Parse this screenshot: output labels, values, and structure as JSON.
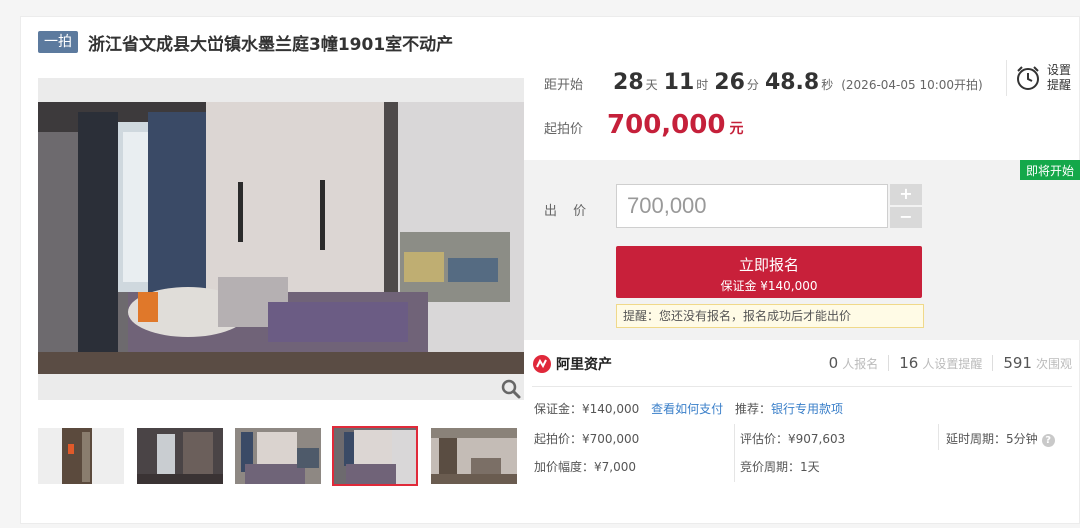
{
  "listing": {
    "tag": "一拍",
    "title": "浙江省文成县大峃镇水墨兰庭3幢1901室不动产"
  },
  "countdown": {
    "label": "距开始",
    "days": "28",
    "days_unit": "天",
    "hours": "11",
    "hours_unit": "时",
    "minutes": "26",
    "minutes_unit": "分",
    "seconds": "48.8",
    "seconds_unit": "秒",
    "start_time": "(2026-04-05 10:00开拍)"
  },
  "reminder": {
    "label": "设置 提醒",
    "icon": "alarm-clock-icon"
  },
  "start_price": {
    "label": "起拍价",
    "value": "700,000",
    "unit": "元"
  },
  "bid": {
    "status_badge": "即将开始",
    "label": "出 价",
    "input_value": "700,000",
    "plus": "+",
    "minus": "−",
    "signup_label": "立即报名",
    "deposit_label": "保证金 ¥140,000",
    "tip": "提醒：您还没有报名，报名成功后才能出价"
  },
  "platform": {
    "name": "阿里资产",
    "stats": [
      {
        "num": "0",
        "label": "人报名"
      },
      {
        "num": "16",
        "label": "人设置提醒"
      },
      {
        "num": "591",
        "label": "次围观"
      }
    ]
  },
  "details": {
    "deposit": "保证金：¥140,000",
    "how_to_pay": "查看如何支付",
    "recommend_label": "推荐：",
    "recommend_link": "银行专用款项",
    "start_price": "起拍价：¥700,000",
    "appraisal": "评估价：¥907,603",
    "delay_period": "延时周期：5分钟",
    "increment": "加价幅度：¥7,000",
    "bidding_period": "竞价周期：1天"
  },
  "colors": {
    "accent_red": "#c8203a",
    "badge_green": "#14a84a",
    "tag_blue": "#5c7a9e",
    "link_blue": "#3a7fc9"
  },
  "gallery": {
    "thumbnail_count": 5,
    "selected_index": 3
  }
}
